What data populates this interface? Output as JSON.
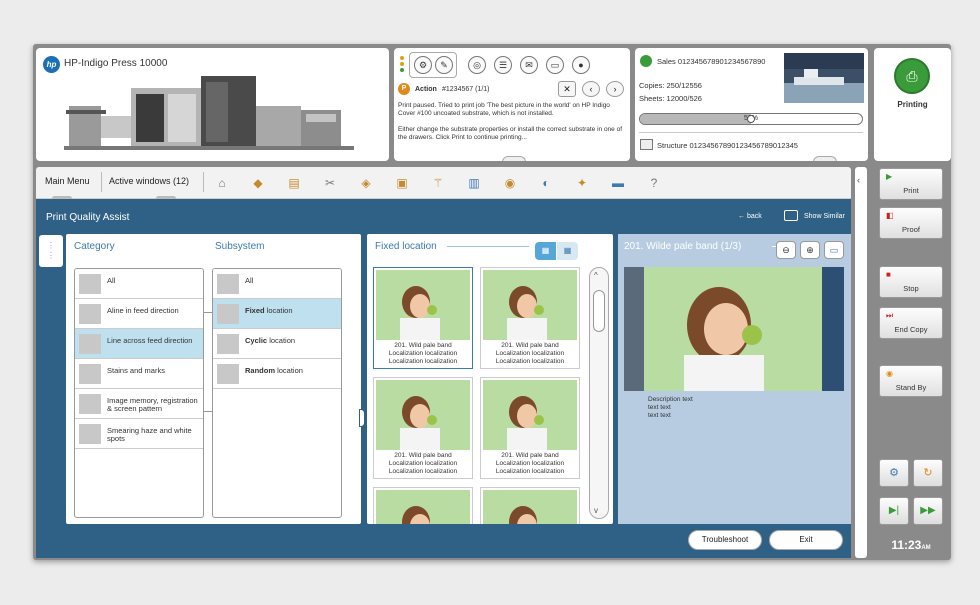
{
  "press": {
    "title": "HP-Indigo Press 10000"
  },
  "action": {
    "label": "Action",
    "job_number": "#1234567 (1/1)",
    "message1": "Print paused. Tried to print job 'The best picture in the world' on HP Indigo Cover #100 uncoated substrate, which is not installed.",
    "message2": "Either change the substrate properties or install the correct substrate in one of the drawers. Click Print to continue printing..."
  },
  "sales": {
    "sales_label": "Sales 01234567890123456789​0",
    "copies": "Copies: 250/12556",
    "sheets": "Sheets: 12000/526",
    "progress_text": "50%",
    "progress_fraction": 0.5,
    "structure": "Structure 0123456789012345678901234​5"
  },
  "status": {
    "label": "Printing"
  },
  "nav": {
    "main_menu": "Main Menu",
    "active_windows": "Active windows (12)"
  },
  "pqa": {
    "title": "Print Quality Assist",
    "back": "back",
    "show_similar": "Show Similar",
    "category_title": "Category",
    "subsystem_title": "Subsystem",
    "categories": [
      "All",
      "Aline in feed direction",
      "Line across feed direction",
      "Stains and marks",
      "Image memory, registration & screen pattern",
      "Smearing haze and white spots"
    ],
    "subsystems": [
      {
        "bold": "",
        "rest": "All"
      },
      {
        "bold": "Fixed",
        "rest": " location"
      },
      {
        "bold": "Cyclic",
        "rest": " location"
      },
      {
        "bold": "Random",
        "rest": " location"
      }
    ],
    "fixed_title": "Fixed location",
    "thumb_line1": "201. Wild pale band",
    "thumb_line2": "Localization localization",
    "thumb_line3": "Localization localization",
    "detail_title": "201. Wilde pale band (1/3)",
    "desc1": "Description text",
    "desc2": "text text",
    "desc3": "text text",
    "troubleshoot": "Troubleshoot",
    "exit": "Exit"
  },
  "side": {
    "print": "Print",
    "proof": "Proof",
    "stop": "Stop",
    "end_copy": "End Copy",
    "stand_by": "Stand By",
    "time": "11:23",
    "ampm": "AM"
  },
  "colors": {
    "accent_blue": "#2f6186",
    "selection": "#bfe1ef",
    "go_green": "#3a9b3a",
    "stop_red": "#d02020"
  }
}
